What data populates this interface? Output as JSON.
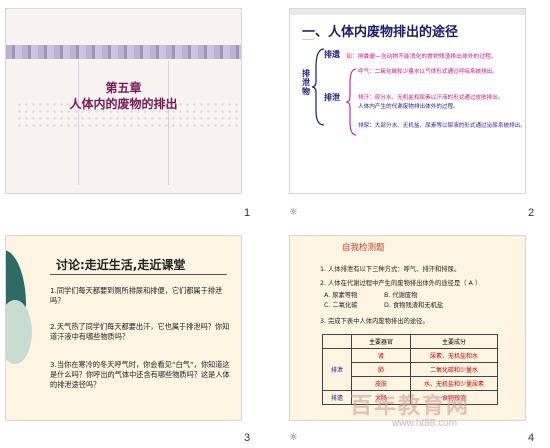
{
  "slides": [
    {
      "number": "1",
      "title_line1": "第五章",
      "title_line2": "人体内的废物的排出"
    },
    {
      "number": "2",
      "heading": "一、人体内废物排出的途径",
      "label_paiyi": "排遗",
      "label_paiyi_def": "如：排粪便—含动物不能消化的食物残渣排出体外的过程。",
      "label_excretion": "排泄物",
      "label_paixie": "排泄",
      "label_paixie_def": "人体内产生的代谢废物排出体外的过程。",
      "hu_qi": "呼气：二氧化碳和少量水以气体形式通过呼吸系统排出。",
      "pai_han": "排汗：部分水、无机盐和尿素以汗液的形式通过皮肤排出。",
      "pai_niao": "排尿：大部分水、无机盐、尿素等以尿液的形式通过泌尿系统排出。"
    },
    {
      "number": "3",
      "heading": "讨论:走近生活,走近课堂",
      "q1": "1.同学们每天都要到厕所排尿和排便，它们都属于排泄吗？",
      "q2": "2.天气热了同学们每天都要出汗，它也属于排泄吗？你知道汗液中有哪些物质吗？",
      "q3": "3.当你在寒冷的冬天呼气时，你会看见“白气”，你知道这是什么吗？你呼出的气体中还含有哪些物质吗？这是人体的排泄途径吗？"
    },
    {
      "number": "4",
      "heading": "自我检测题",
      "line1": "1. 人体排泄有以下三种方式：呼气、排汗和排尿。",
      "line2": "2. 人体在代谢过程中产生的废物排出体外的途径是（ A ）",
      "opt_a": "A. 尿素等物",
      "opt_b": "B. 代谢废物",
      "opt_c": "C. 二氧化碳",
      "opt_d": "D. 食物残渣和无机盐",
      "line3": "3. 完成下表中人体内废物排出的途径。",
      "table_headers": [
        "主要器官",
        "主要成分"
      ],
      "table_group_label": "排泄",
      "table_group_label2": "排遗",
      "table_rows": [
        [
          "肾",
          "尿素、无机盐和水"
        ],
        [
          "肺",
          "二氧化碳和少量水"
        ],
        [
          "皮肤",
          "水、无机盐和少量尿素"
        ],
        [
          "大肠",
          "食物残渣"
        ]
      ]
    }
  ],
  "watermark": "百年教育网",
  "watermark_url": "www.ht88.com"
}
